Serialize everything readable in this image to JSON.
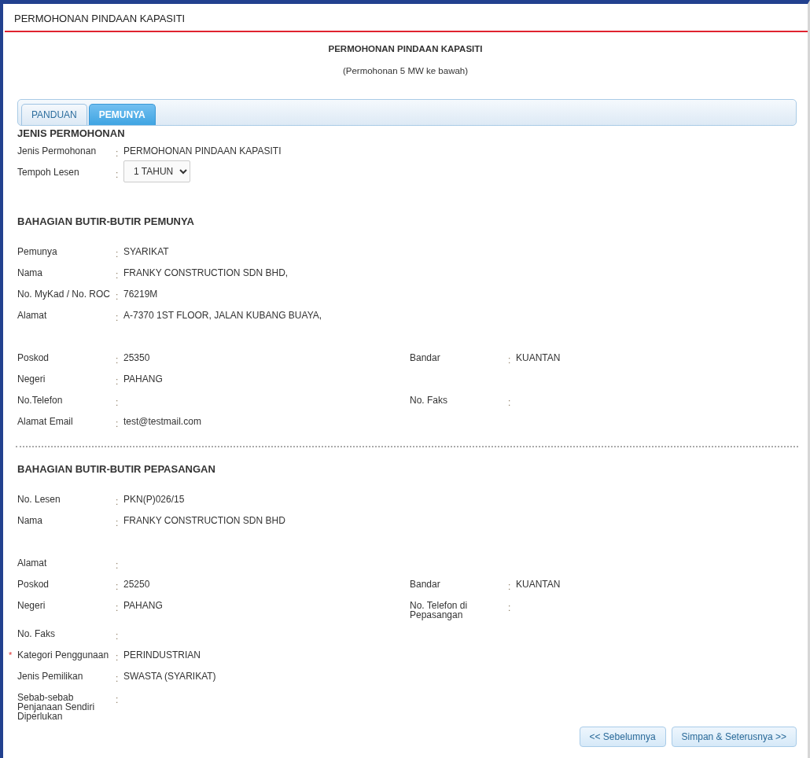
{
  "page_title": "PERMOHONAN PINDAAN KAPASITI",
  "heading": {
    "title": "PERMOHONAN PINDAAN KAPASITI",
    "subtitle": "(Permohonan 5 MW ke bawah)"
  },
  "tabs": [
    {
      "label": "PANDUAN",
      "selected": false
    },
    {
      "label": "PEMUNYA",
      "selected": true
    }
  ],
  "sections": [
    {
      "title": "JENIS PERMOHONAN",
      "rows": [
        {
          "kind": "pair",
          "left": {
            "label": "Jenis Permohonan",
            "colon": ":",
            "value": "PERMOHONAN PINDAAN KAPASITI"
          }
        },
        {
          "kind": "pair",
          "left": {
            "label": "Tempoh Lesen",
            "colon": ":",
            "select": "1 TAHUN"
          }
        }
      ]
    },
    {
      "title": "BAHAGIAN BUTIR-BUTIR PEMUNYA",
      "rows": [
        {
          "kind": "pair",
          "left": {
            "label": "Pemunya",
            "colon": ":",
            "value": "SYARIKAT"
          }
        },
        {
          "kind": "pair",
          "left": {
            "label": "Nama",
            "colon": ":",
            "value": "FRANKY CONSTRUCTION SDN BHD,"
          }
        },
        {
          "kind": "pair",
          "left": {
            "label": "No. MyKad / No. ROC",
            "colon": ":",
            "value": "76219M"
          }
        },
        {
          "kind": "pair",
          "left": {
            "label": "Alamat",
            "colon": ":",
            "value": "A-7370 1ST FLOOR, JALAN KUBANG BUAYA,"
          }
        },
        {
          "kind": "blank"
        },
        {
          "kind": "pair",
          "left": {
            "label": "Poskod",
            "colon": ":",
            "value": "25350"
          },
          "right": {
            "label": "Bandar",
            "colon": ":",
            "value": "KUANTAN"
          }
        },
        {
          "kind": "pair",
          "left": {
            "label": "Negeri",
            "colon": ":",
            "value": "PAHANG"
          }
        },
        {
          "kind": "pair",
          "left": {
            "label": "No.Telefon",
            "colon": ":"
          },
          "right": {
            "label": "No. Faks",
            "colon": ":"
          }
        },
        {
          "kind": "pair",
          "left": {
            "label": "Alamat Email",
            "colon": ":",
            "value": "test@testmail.com"
          }
        }
      ]
    },
    {
      "title": "BAHAGIAN BUTIR-BUTIR PEPASANGAN",
      "rows": [
        {
          "kind": "pair",
          "left": {
            "label": "No. Lesen",
            "colon": ":",
            "value": "PKN(P)026/15"
          }
        },
        {
          "kind": "pair",
          "left": {
            "label": "Nama",
            "colon": ":",
            "value": "FRANKY CONSTRUCTION SDN BHD"
          }
        },
        {
          "kind": "blank"
        },
        {
          "kind": "pair",
          "left": {
            "label": "Alamat",
            "colon": ":"
          }
        },
        {
          "kind": "pair",
          "left": {
            "label": "Poskod",
            "colon": ":",
            "value": "25250"
          },
          "right": {
            "label": "Bandar",
            "colon": ":",
            "value": "KUANTAN"
          }
        },
        {
          "kind": "pair",
          "left": {
            "label": "Negeri",
            "colon": ":",
            "value": "PAHANG"
          },
          "right": {
            "label": "No. Telefon di Pepasangan",
            "colon": ":"
          }
        },
        {
          "kind": "pair",
          "left": {
            "label": "No. Faks",
            "colon": ":"
          }
        },
        {
          "kind": "pair",
          "left": {
            "label": "Kategori Penggunaan",
            "colon": ":",
            "value": "PERINDUSTRIAN",
            "marker": "*"
          }
        },
        {
          "kind": "pair",
          "left": {
            "label": "Jenis Pemilikan",
            "colon": ":",
            "value": "SWASTA (SYARIKAT)"
          }
        },
        {
          "kind": "pair",
          "left": {
            "label": "Sebab-sebab Penjanaan Sendiri Diperlukan",
            "colon": ":"
          }
        }
      ]
    }
  ],
  "buttons": [
    "<< Sebelumnya",
    "Simpan & Seterusnya >>"
  ]
}
